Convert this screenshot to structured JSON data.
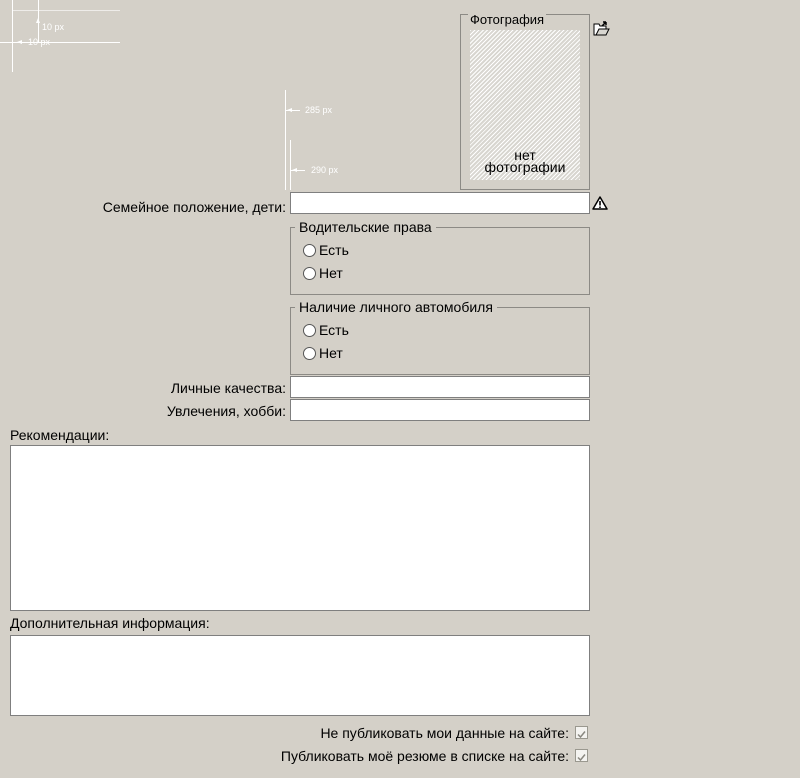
{
  "guides": {
    "top_left_h": "10 px",
    "top_left_v": "10 px",
    "indent_285": "285 px",
    "indent_290": "290 px"
  },
  "photo": {
    "legend": "Фотография",
    "no_photo_line1": "нет",
    "no_photo_line2": "фотографии"
  },
  "fields": {
    "marital_label": "Семейное положение, дети:",
    "marital_value": "",
    "qualities_label": "Личные качества:",
    "qualities_value": "",
    "hobbies_label": "Увлечения, хобби:",
    "hobbies_value": "",
    "recommendations_label": "Рекомендации:",
    "recommendations_value": "",
    "additional_label": "Дополнительная информация:",
    "additional_value": ""
  },
  "license": {
    "legend": "Водительские права",
    "yes": "Есть",
    "no": "Нет"
  },
  "car": {
    "legend": "Наличие личного автомобиля",
    "yes": "Есть",
    "no": "Нет"
  },
  "options": {
    "do_not_publish_label": "Не публиковать мои данные на сайте:",
    "do_not_publish_checked": true,
    "publish_resume_label": "Публиковать моё резюме в списке на сайте:",
    "publish_resume_checked": true
  },
  "icons": {
    "upload": "folder-upload-icon",
    "warning": "warning-icon"
  }
}
